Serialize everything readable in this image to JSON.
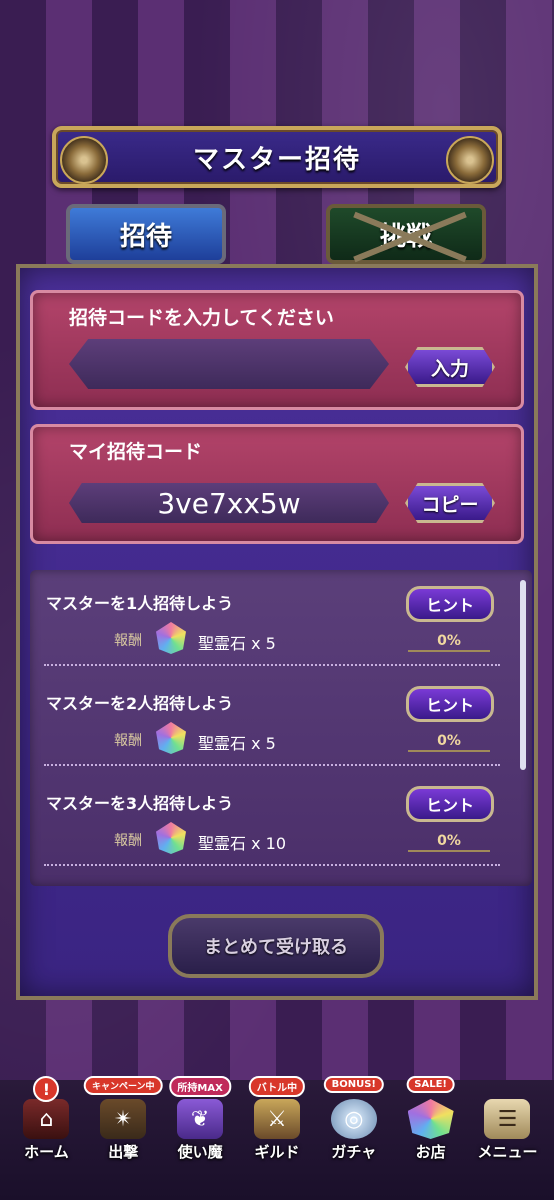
{
  "title": "マスター招待",
  "tabs": [
    {
      "label": "招待",
      "active": true
    },
    {
      "label": "挑戦",
      "active": false,
      "locked": true
    }
  ],
  "invite_input": {
    "label": "招待コードを入力してください",
    "placeholder": "",
    "button_label": "入力"
  },
  "my_code": {
    "label": "マイ招待コード",
    "value": "3ve7xx5w",
    "button_label": "コピー"
  },
  "missions": [
    {
      "title": "マスターを1人招待しよう",
      "reward_label": "報酬",
      "reward": "聖霊石 x 5",
      "hint_label": "ヒント",
      "progress": "0%"
    },
    {
      "title": "マスターを2人招待しよう",
      "reward_label": "報酬",
      "reward": "聖霊石 x 5",
      "hint_label": "ヒント",
      "progress": "0%"
    },
    {
      "title": "マスターを3人招待しよう",
      "reward_label": "報酬",
      "reward": "聖霊石 x 10",
      "hint_label": "ヒント",
      "progress": "0%"
    }
  ],
  "collect_all_label": "まとめて受け取る",
  "nav": [
    {
      "label": "ホーム",
      "badge": "!",
      "icon": "home-icon"
    },
    {
      "label": "出撃",
      "badge": "キャンペーン中",
      "icon": "book-icon"
    },
    {
      "label": "使い魔",
      "badge": "所持MAX",
      "icon": "familiar-icon"
    },
    {
      "label": "ギルド",
      "badge": "バトル中",
      "icon": "guild-icon"
    },
    {
      "label": "ガチャ",
      "badge": "BONUS!",
      "icon": "gacha-icon"
    },
    {
      "label": "お店",
      "badge": "SALE!",
      "icon": "shop-icon"
    },
    {
      "label": "メニュー",
      "badge": "",
      "icon": "menu-icon"
    }
  ]
}
